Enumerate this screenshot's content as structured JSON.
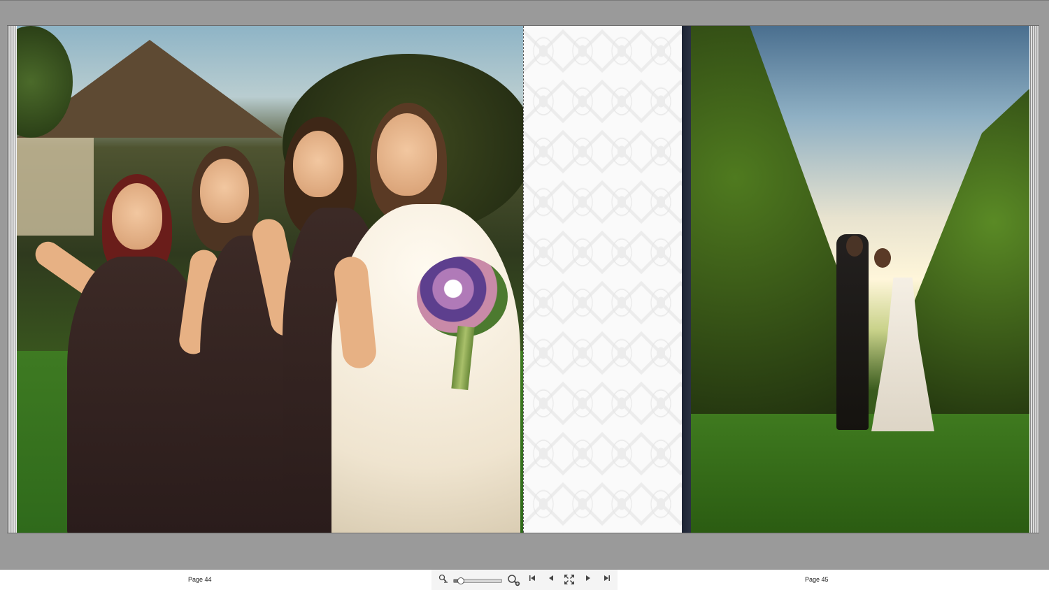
{
  "viewer": {
    "left_page_label": "Page 44",
    "right_page_label": "Page 45",
    "zoom_level": 0.15
  },
  "toolbar_icons": [
    "zoom-out-icon",
    "zoom-in-icon",
    "first-page-icon",
    "previous-page-icon",
    "fit-to-screen-icon",
    "next-page-icon",
    "last-page-icon"
  ],
  "colors": {
    "background": "#9a9a9a",
    "toolbar": "#ffffff",
    "spine": "#1d2433"
  }
}
